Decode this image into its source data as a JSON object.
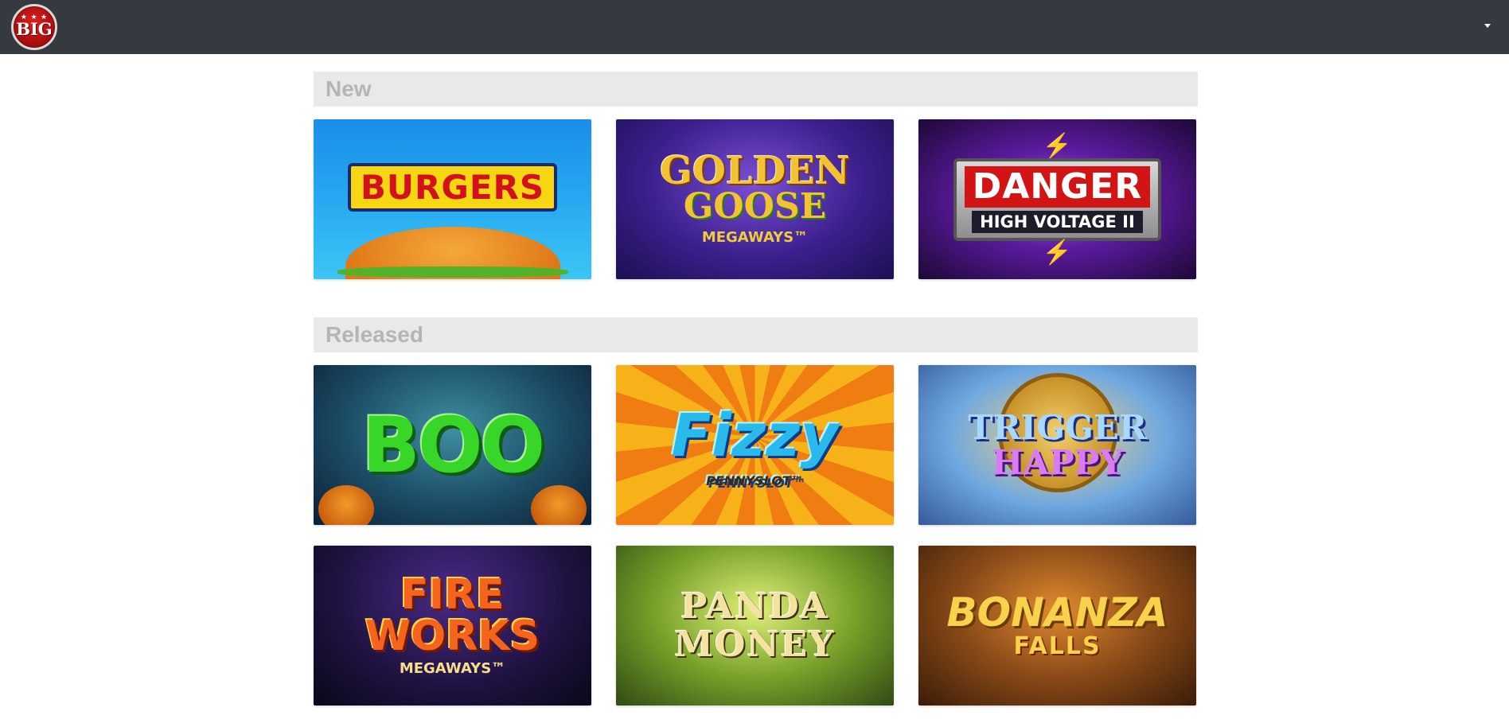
{
  "header": {
    "logo": {
      "icon": "big-time-gaming-logo",
      "stars": "★ ★ ★",
      "text": "BIG"
    },
    "menu_icon": "caret-down-icon"
  },
  "sections": [
    {
      "title": "New",
      "games": [
        {
          "title": "BURGERS",
          "icon": "burgers-game-art"
        },
        {
          "title_lines": [
            "GOLDEN",
            "GOOSE",
            "MEGAWAYS™"
          ],
          "icon": "golden-goose-game-art"
        },
        {
          "title_lines": [
            "DANGER",
            "HIGH VOLTAGE II"
          ],
          "icon": "danger-high-voltage-game-art"
        }
      ]
    },
    {
      "title": "Released",
      "games": [
        {
          "title": "BOO",
          "icon": "boo-game-art"
        },
        {
          "title": "Fizzy",
          "subtitle": "PENNYSLOT™",
          "icon": "fizzy-game-art"
        },
        {
          "title_lines": [
            "TRIGGER",
            "HAPPY"
          ],
          "icon": "trigger-happy-game-art"
        },
        {
          "title_lines": [
            "FIRE",
            "WORKS",
            "MEGAWAYS™"
          ],
          "icon": "fireworks-game-art"
        },
        {
          "title_lines": [
            "PANDA",
            "MONEY"
          ],
          "icon": "panda-money-game-art"
        },
        {
          "title_lines": [
            "BONANZA",
            "FALLS"
          ],
          "icon": "bonanza-falls-game-art"
        }
      ]
    }
  ],
  "colors": {
    "topbar": "#343a40",
    "section_header_bg": "#e9e9e9",
    "section_title": "#b5b5b5"
  }
}
